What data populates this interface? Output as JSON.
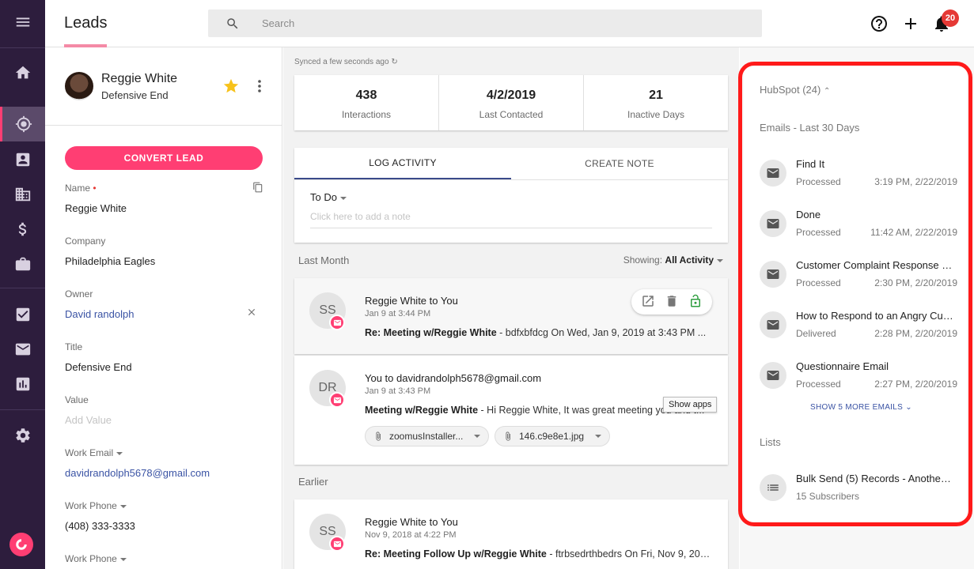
{
  "app": {
    "page_title": "Leads",
    "search_placeholder": "Search",
    "notification_count": "20",
    "brand_color": "#ff3e73"
  },
  "nav": {
    "items": [
      "menu-icon",
      "home-icon",
      "leads-icon",
      "contacts-icon",
      "companies-icon",
      "deals-icon",
      "briefcase-icon",
      "tasks-icon",
      "mail-icon",
      "reports-icon",
      "settings-icon"
    ],
    "active": "leads-icon"
  },
  "lead": {
    "name": "Reggie White",
    "role": "Defensive End",
    "convert_label": "CONVERT LEAD",
    "fields": [
      {
        "label": "Name",
        "value": "Reggie White",
        "required": true
      },
      {
        "label": "Company",
        "value": "Philadelphia Eagles"
      },
      {
        "label": "Owner",
        "value": "David randolph"
      },
      {
        "label": "Title",
        "value": "Defensive End"
      },
      {
        "label": "Value",
        "value": "Add Value"
      },
      {
        "label": "Work Email",
        "value": "davidrandolph5678@gmail.com"
      },
      {
        "label": "Work Phone",
        "value": "(408) 333-3333"
      },
      {
        "label": "Work Phone",
        "value": ""
      }
    ],
    "required_marker": "•"
  },
  "feed": {
    "synced": "Synced a few seconds ago",
    "stats": [
      {
        "value": "438",
        "label": "Interactions"
      },
      {
        "value": "4/2/2019",
        "label": "Last Contacted"
      },
      {
        "value": "21",
        "label": "Inactive Days"
      }
    ],
    "tabs": [
      "LOG ACTIVITY",
      "CREATE NOTE"
    ],
    "todo": "To Do",
    "note_placeholder": "Click here to add a note",
    "section_last_month": "Last Month",
    "showing_label": "Showing:",
    "showing_value": "All Activity",
    "section_earlier": "Earlier",
    "tooltip": "Show apps",
    "activities": [
      {
        "initials": "SS",
        "title": "Reggie White to You",
        "time": "Jan 9 at 3:44 PM",
        "subject": "Re: Meeting w/Reggie White",
        "snippet": " - bdfxbfdcg On Wed, Jan 9, 2019 at 3:43 PM ..."
      },
      {
        "initials": "DR",
        "title": "You to davidrandolph5678@gmail.com",
        "time": "Jan 9 at 3:43 PM",
        "subject": "Meeting w/Reggie White",
        "snippet": " - Hi Reggie White, It was great meeting you and t...",
        "attachments": [
          "zoomusInstaller...",
          "146.c9e8e1.jpg"
        ]
      },
      {
        "initials": "SS",
        "title": "Reggie White to You",
        "time": "Nov 9, 2018 at 4:22 PM",
        "subject": "Re: Meeting Follow Up w/Reggie White",
        "snippet": " - ftrbsedrthbedrs On Fri, Nov 9, 201..."
      }
    ]
  },
  "hubspot": {
    "header": "HubSpot (24)",
    "emails_label": "Emails - Last 30 Days",
    "emails": [
      {
        "subject": "Find It",
        "status": "Processed",
        "date": "3:19 PM, 2/22/2019"
      },
      {
        "subject": "Done",
        "status": "Processed",
        "date": "11:42 AM, 2/22/2019"
      },
      {
        "subject": "Customer Complaint Response L...",
        "status": "Processed",
        "date": "2:30 PM, 2/20/2019"
      },
      {
        "subject": "How to Respond to an Angry Cust...",
        "status": "Delivered",
        "date": "2:28 PM, 2/20/2019"
      },
      {
        "subject": "Questionnaire Email",
        "status": "Processed",
        "date": "2:27 PM, 2/20/2019"
      }
    ],
    "show_more": "SHOW 5 MORE EMAILS",
    "lists_label": "Lists",
    "list_item": {
      "name": "Bulk Send (5) Records - Another ...",
      "detail": "15 Subscribers"
    },
    "highlight_color": "#ff1a1a"
  }
}
